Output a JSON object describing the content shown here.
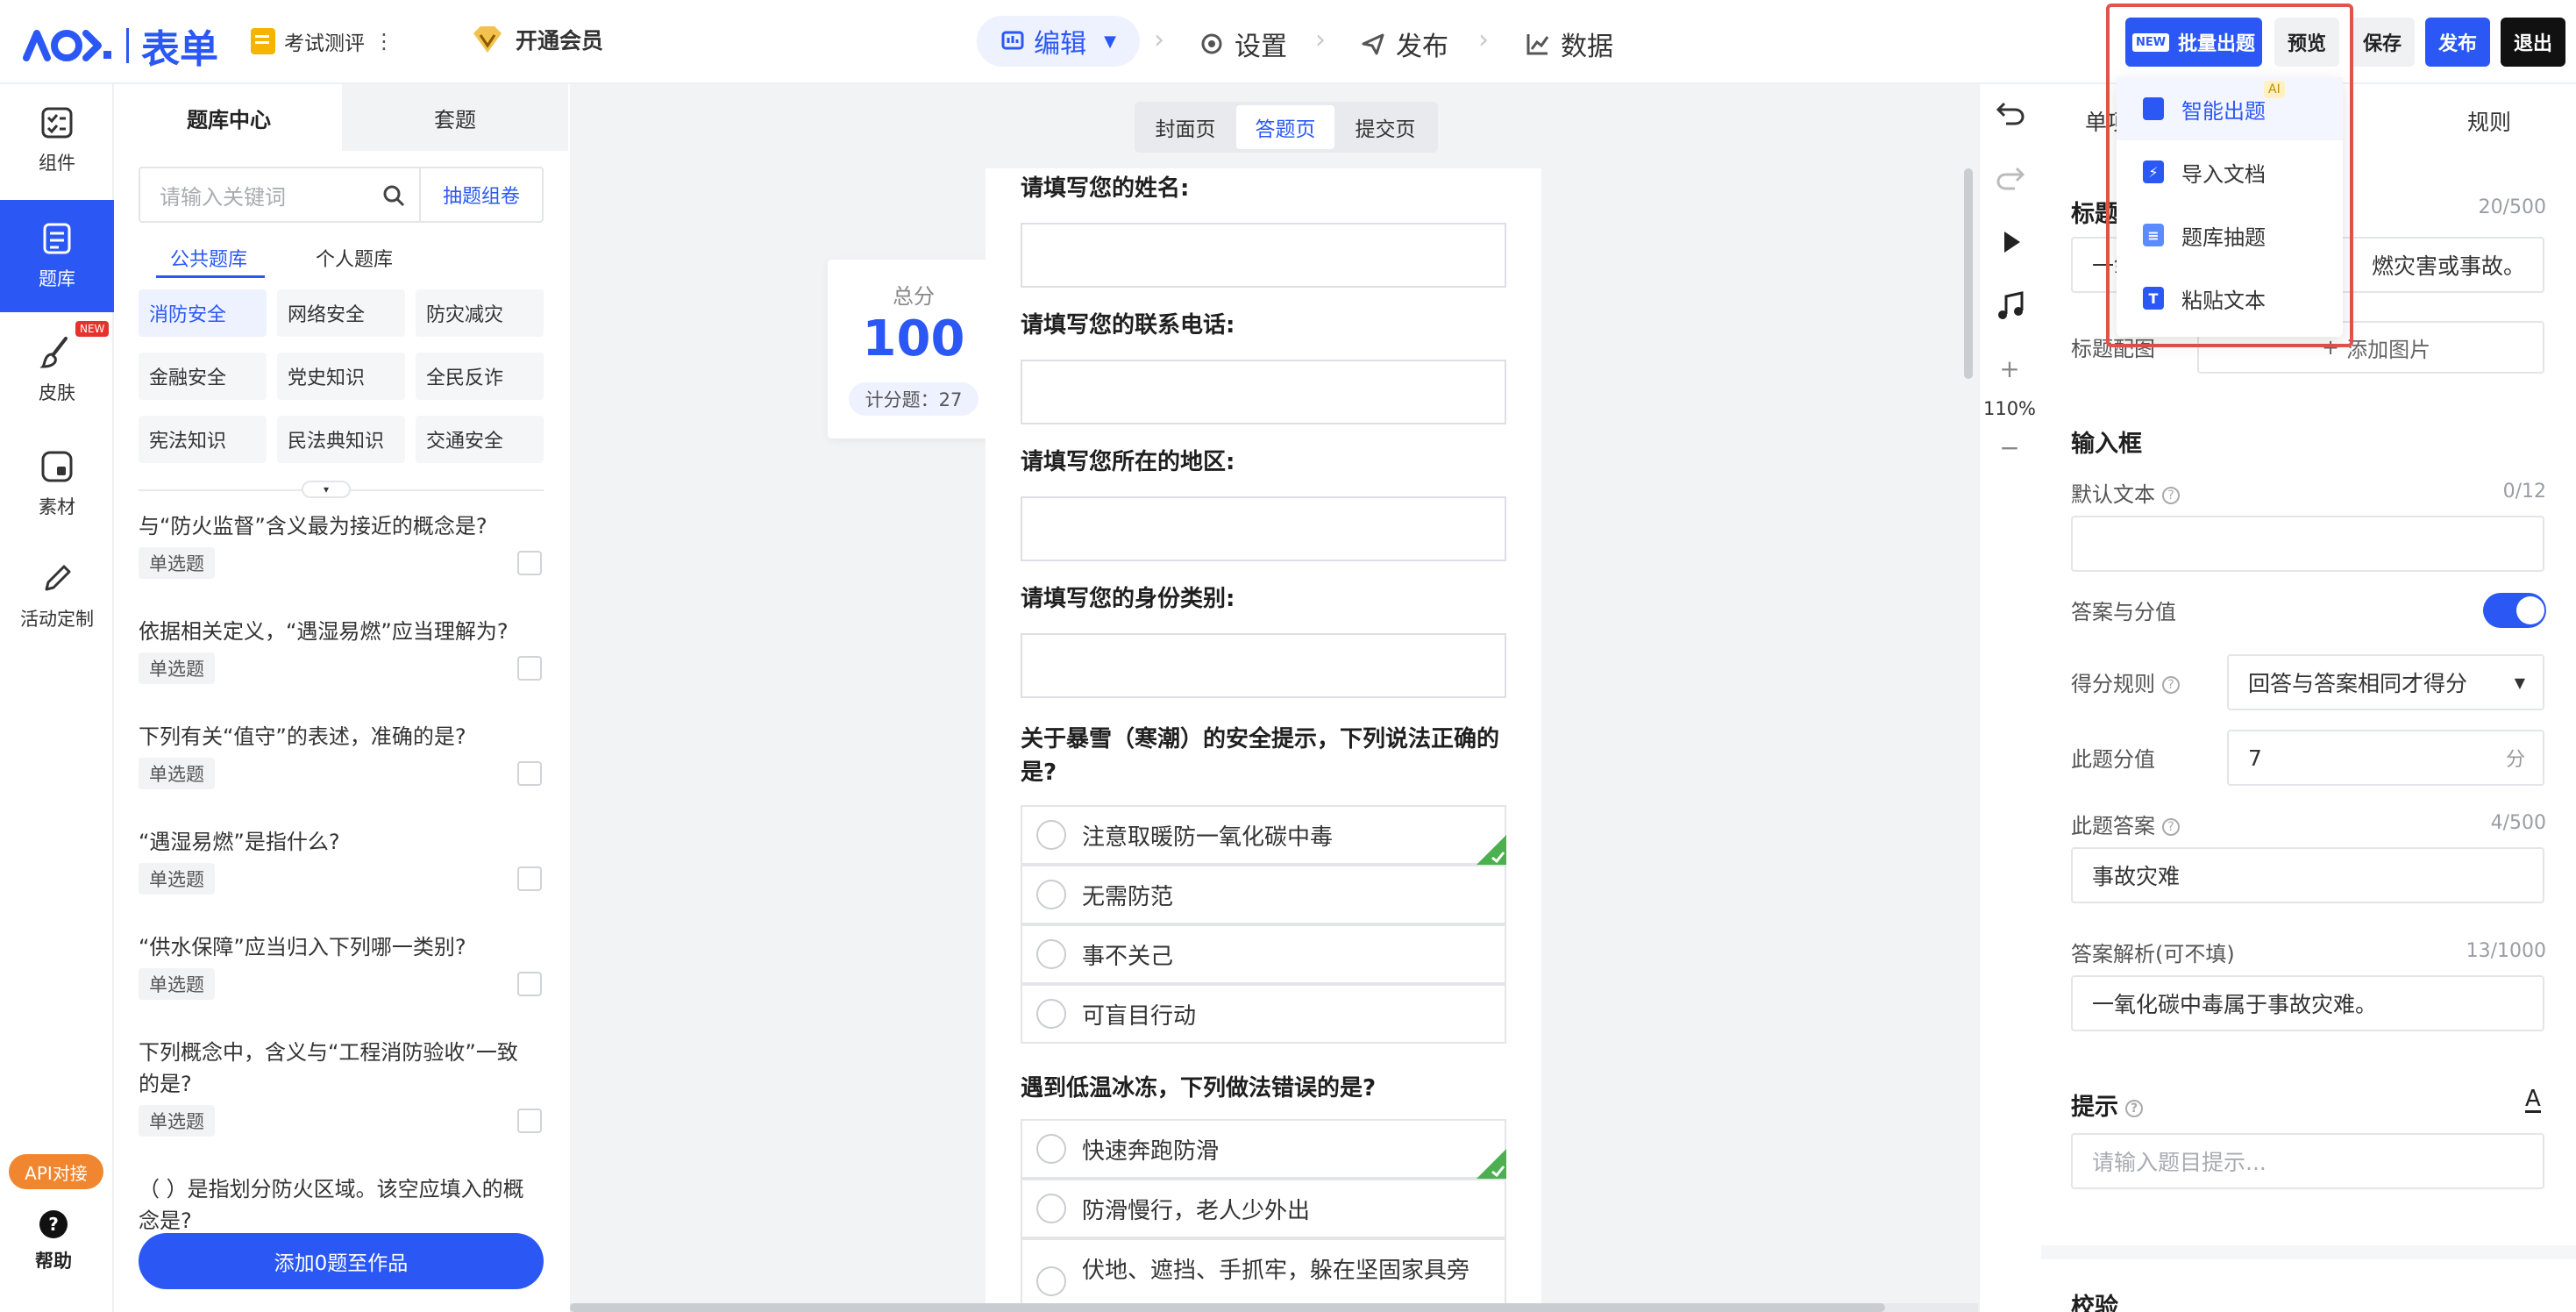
{
  "brand": {
    "name": "表单",
    "accent": "#2b58f5",
    "danger": "#e1544b"
  },
  "project": {
    "title": "考试测评",
    "more": "⋮",
    "vip_label": "开通会员"
  },
  "nav_tabs": [
    {
      "label": "编辑",
      "icon": "edit-icon",
      "active": true
    },
    {
      "label": "设置",
      "icon": "gear-icon"
    },
    {
      "label": "发布",
      "icon": "send-icon"
    },
    {
      "label": "数据",
      "icon": "chart-icon"
    }
  ],
  "top_actions": {
    "batch": "批量出题",
    "new_badge": "NEW",
    "preview": "预览",
    "save": "保存",
    "publish": "发布",
    "exit": "退出"
  },
  "dropdown": {
    "ai_badge": "AI",
    "items": [
      "智能出题",
      "导入文档",
      "题库抽题",
      "粘贴文本"
    ]
  },
  "left_nav": [
    {
      "label": "组件",
      "icon": "component-icon"
    },
    {
      "label": "题库",
      "icon": "question-bank-icon",
      "active": true
    },
    {
      "label": "皮肤",
      "icon": "brush-icon",
      "badge": "NEW"
    },
    {
      "label": "素材",
      "icon": "material-icon"
    },
    {
      "label": "活动定制",
      "icon": "pencil-icon"
    }
  ],
  "left_bottom": {
    "api": "API对接",
    "help": "帮助"
  },
  "bank": {
    "tabs": [
      "题库中心",
      "套题"
    ],
    "search_placeholder": "请输入关键词",
    "draw_button": "抽题组卷",
    "sub_tabs": [
      "公共题库",
      "个人题库"
    ],
    "tags": [
      "消防安全",
      "网络安全",
      "防灾减灾",
      "金融安全",
      "党史知识",
      "全民反诈",
      "宪法知识",
      "民法典知识",
      "交通安全"
    ],
    "questions": [
      {
        "text": "与“防火监督”含义最为接近的概念是?",
        "type": "单选题"
      },
      {
        "text": "依据相关定义，“遇湿易燃”应当理解为?",
        "type": "单选题"
      },
      {
        "text": "下列有关“值守”的表述，准确的是?",
        "type": "单选题"
      },
      {
        "text": "“遇湿易燃”是指什么?",
        "type": "单选题"
      },
      {
        "text": "“供水保障”应当归入下列哪一类别?",
        "type": "单选题"
      },
      {
        "text": "下列概念中，含义与“工程消防验收”一致的是?",
        "type": "单选题"
      },
      {
        "text": "（ ）是指划分防火区域。该空应填入的概念是?",
        "type": ""
      }
    ],
    "add_button": "添加0题至作品"
  },
  "page_tabs": [
    "封面页",
    "答题页",
    "提交页"
  ],
  "score_card": {
    "label": "总分",
    "value": "100",
    "sub": "计分题：27"
  },
  "form": {
    "fields": [
      "请填写您的姓名:",
      "请填写您的联系电话:",
      "请填写您所在的地区:",
      "请填写您的身份类别:"
    ],
    "q1": {
      "title": "关于暴雪（寒潮）的安全提示，下列说法正确的是?",
      "options": [
        "注意取暖防一氧化碳中毒",
        "无需防范",
        "事不关己",
        "可盲目行动"
      ],
      "correct_index": 0
    },
    "q2": {
      "title": "遇到低温冰冻，下列做法错误的是?",
      "options": [
        "快速奔跑防滑",
        "防滑慢行，老人少外出",
        "伏地、遮挡、手抓牢，躲在坚固家具旁"
      ],
      "correct_index": 0
    }
  },
  "tools": {
    "zoom": "110%",
    "plus": "+",
    "minus": "−"
  },
  "props": {
    "tabs": [
      "单项",
      "规则"
    ],
    "title_label": "标题",
    "title_count": "20/500",
    "title_value_left": "一氧",
    "title_value_right": "燃灾害或事故。",
    "title_img_label": "标题配图",
    "add_image": "添加图片",
    "input_section": "输入框",
    "default_text_label": "默认文本",
    "default_text_count": "0/12",
    "answer_score_label": "答案与分值",
    "answer_score_on": true,
    "score_rule_label": "得分规则",
    "score_rule_value": "回答与答案相同才得分",
    "score_label": "此题分值",
    "score_value": "7",
    "score_unit": "分",
    "answer_label": "此题答案",
    "answer_count": "4/500",
    "answer_value": "事故灾难",
    "analysis_label": "答案解析(可不填)",
    "analysis_count": "13/1000",
    "analysis_value": "一氧化碳中毒属于事故灾难。",
    "hint_label": "提示",
    "hint_placeholder": "请输入题目提示...",
    "verify_label": "校验"
  }
}
